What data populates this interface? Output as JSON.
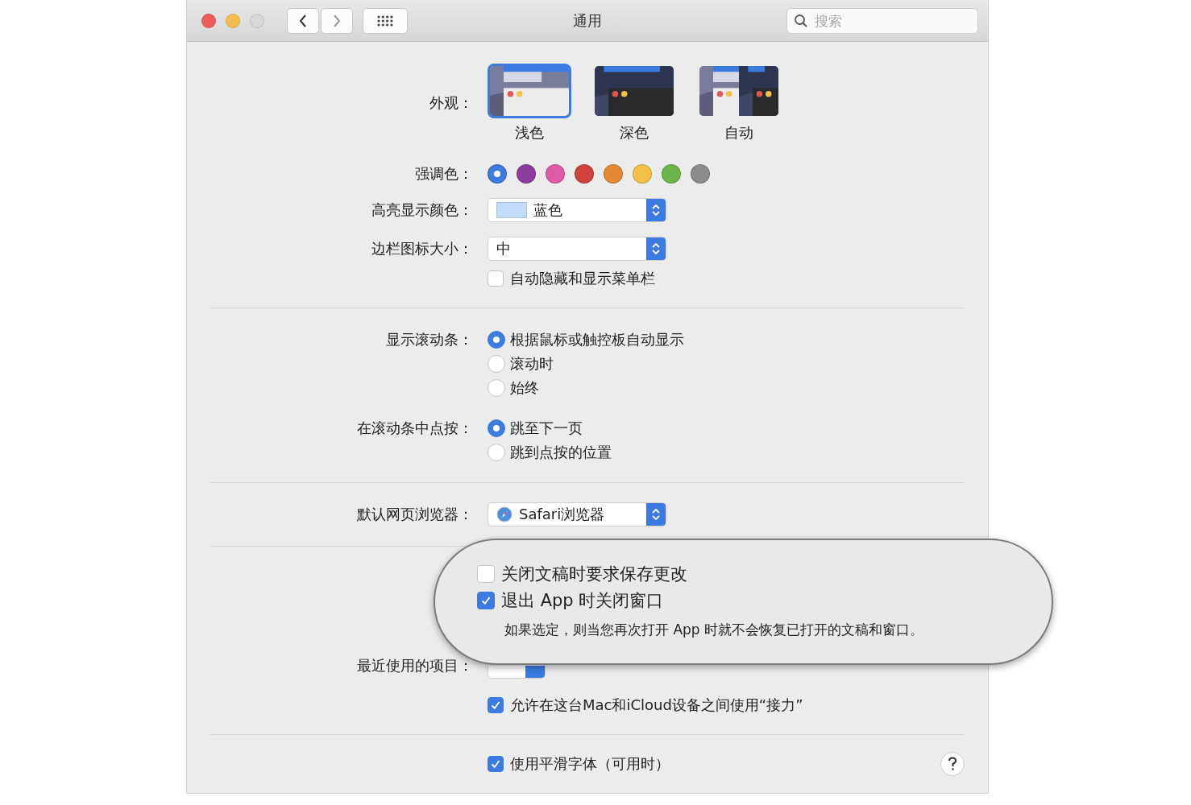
{
  "window": {
    "title": "通用"
  },
  "toolbar": {
    "search": {
      "placeholder": "搜索"
    }
  },
  "appearance": {
    "label": "外观：",
    "options": [
      {
        "label": "浅色",
        "kind": "light",
        "selected": true
      },
      {
        "label": "深色",
        "kind": "dark",
        "selected": false
      },
      {
        "label": "自动",
        "kind": "auto",
        "selected": false
      }
    ]
  },
  "accent_color": {
    "label": "强调色：",
    "swatches": [
      {
        "color": "#3b7ae0",
        "selected": true
      },
      {
        "color": "#8e3d9e",
        "selected": false
      },
      {
        "color": "#e05aa5",
        "selected": false
      },
      {
        "color": "#d0423b",
        "selected": false
      },
      {
        "color": "#e58a34",
        "selected": false
      },
      {
        "color": "#f2c14a",
        "selected": false
      },
      {
        "color": "#6db54a",
        "selected": false
      },
      {
        "color": "#8c8c8c",
        "selected": false
      }
    ]
  },
  "highlight_color": {
    "label": "高亮显示颜色：",
    "value": "蓝色"
  },
  "sidebar_icon_size": {
    "label": "边栏图标大小：",
    "value": "中"
  },
  "auto_hide_menu_bar": {
    "label": "自动隐藏和显示菜单栏",
    "checked": false
  },
  "show_scroll_bars": {
    "label": "显示滚动条：",
    "options": [
      {
        "label": "根据鼠标或触控板自动显示",
        "selected": true
      },
      {
        "label": "滚动时",
        "selected": false
      },
      {
        "label": "始终",
        "selected": false
      }
    ]
  },
  "click_in_scroll_bar": {
    "label": "在滚动条中点按：",
    "options": [
      {
        "label": "跳至下一页",
        "selected": true
      },
      {
        "label": "跳到点按的位置",
        "selected": false
      }
    ]
  },
  "default_browser": {
    "label": "默认网页浏览器：",
    "value": "Safari浏览器"
  },
  "recent_items": {
    "label": "最近使用的项目："
  },
  "handoff": {
    "label": "允许在这台Mac和iCloud设备之间使用“接力”",
    "checked": true
  },
  "font_smoothing": {
    "label": "使用平滑字体（可用时）",
    "checked": true
  },
  "callout": {
    "items": [
      {
        "label": "关闭文稿时要求保存更改",
        "checked": false
      },
      {
        "label": "退出 App 时关闭窗口",
        "checked": true
      }
    ],
    "note": "如果选定，则当您再次打开 App 时就不会恢复已打开的文稿和窗口。"
  }
}
